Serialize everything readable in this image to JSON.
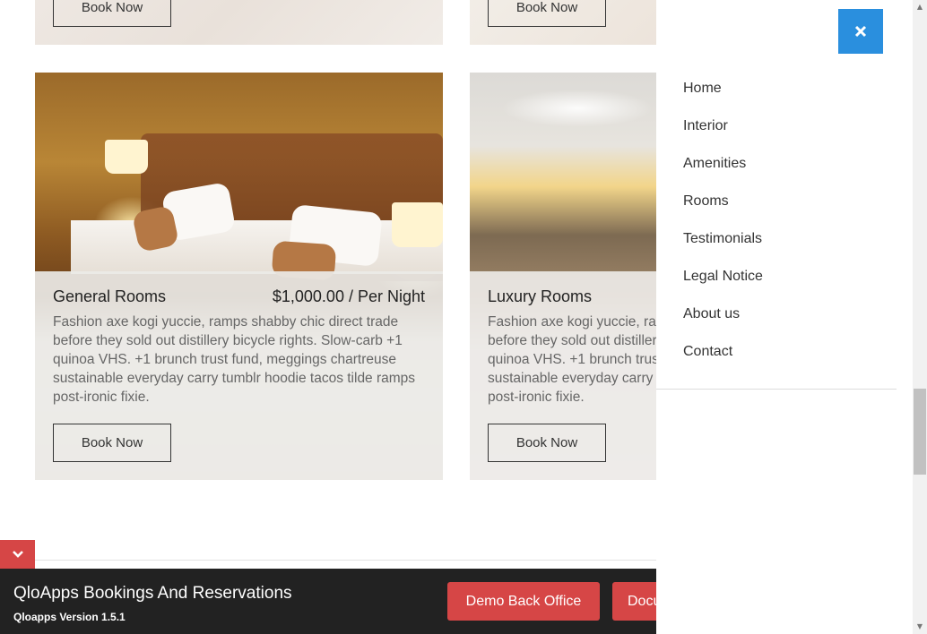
{
  "cards": {
    "top_left_book": "Book Now",
    "top_right_book": "Book Now",
    "general": {
      "title": "General Rooms",
      "price": "$1,000.00 / Per Night",
      "description": "Fashion axe kogi yuccie, ramps shabby chic direct trade before they sold out distillery bicycle rights. Slow-carb +1 quinoa VHS. +1 brunch trust fund, meggings chartreuse sustainable everyday carry tumblr hoodie tacos tilde ramps post-ironic fixie.",
      "book_label": "Book Now"
    },
    "luxury": {
      "title": "Luxury Rooms",
      "description": "Fashion axe kogi yuccie, ramps shabby chic direct trade before they sold out distillery bicycle rights. Slow-carb +1 quinoa VHS. +1 brunch trust fund, meggings chartreuse sustainable everyday carry tumblr hoodie tacos tilde ramps post-ironic fixie.",
      "book_label": "Book Now"
    }
  },
  "side_menu": {
    "items": [
      {
        "label": "Home"
      },
      {
        "label": "Interior"
      },
      {
        "label": "Amenities"
      },
      {
        "label": "Rooms"
      },
      {
        "label": "Testimonials"
      },
      {
        "label": "Legal Notice"
      },
      {
        "label": "About us"
      },
      {
        "label": "Contact"
      }
    ],
    "close_icon": "close-icon"
  },
  "bottom_bar": {
    "title": "QloApps Bookings And Reservations",
    "version": "Qloapps Version 1.5.1",
    "demo_button": "Demo Back Office",
    "docs_button": "Docu"
  },
  "colors": {
    "accent_red": "#d64646",
    "close_blue": "#2a8fde",
    "bar_dark": "#222222"
  }
}
